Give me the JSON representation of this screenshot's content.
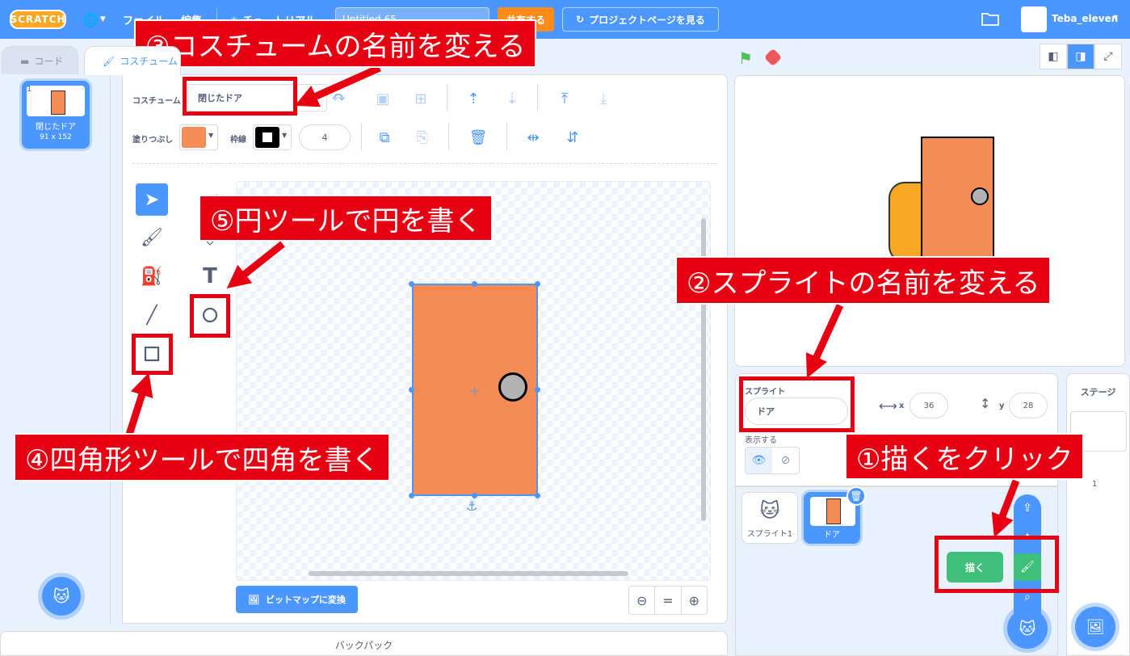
{
  "menubar": {
    "logo": "SCRATCH",
    "file_menu": "ファイル",
    "edit_menu": "編集",
    "tutorial_menu": "チュートリアル",
    "project_title": "Untitled-65",
    "share_button": "共有する",
    "project_page_button": "プロジェクトページを見る",
    "username": "Teba_eleven"
  },
  "tabs": {
    "code": "コード",
    "costumes": "コスチューム"
  },
  "costume_list": {
    "items": [
      {
        "number": "1",
        "name": "閉じたドア",
        "size": "91 x 152"
      }
    ]
  },
  "paint_editor": {
    "costume_label": "コスチューム",
    "costume_name": "閉じたドア",
    "fill_label": "塗りつぶし",
    "outline_label": "枠線",
    "stroke_width": "4",
    "fill_color": "#f58c56",
    "outline_color": "#000000",
    "convert_bitmap_button": "ビットマップに変換",
    "zoom_out": "⊖",
    "zoom_reset": "=",
    "zoom_in": "⊕"
  },
  "backpack": "バックパック",
  "sprite_info": {
    "sprite_label": "スプライト",
    "sprite_name": "ドア",
    "x_label": "x",
    "x_value": "36",
    "y_label": "y",
    "y_value": "28",
    "show_label": "表示する"
  },
  "sprites": [
    {
      "name": "スプライト1"
    },
    {
      "name": "ドア"
    }
  ],
  "paint_tooltip": "描く",
  "stage_panel": {
    "title": "ステージ",
    "backdrop_count": "1"
  },
  "annotations": {
    "step1": "①描くをクリック",
    "step2": "②スプライトの名前を変える",
    "step3": "③コスチュームの名前を変える",
    "step4": "④四角形ツールで四角を書く",
    "step5": "⑤円ツールで円を書く"
  },
  "colors": {
    "menubar": "#4c97ff",
    "accent": "#4c97ff",
    "annotation_red": "#e60012",
    "paint_green": "#3fc07a",
    "share_orange": "#ff8c1a"
  }
}
